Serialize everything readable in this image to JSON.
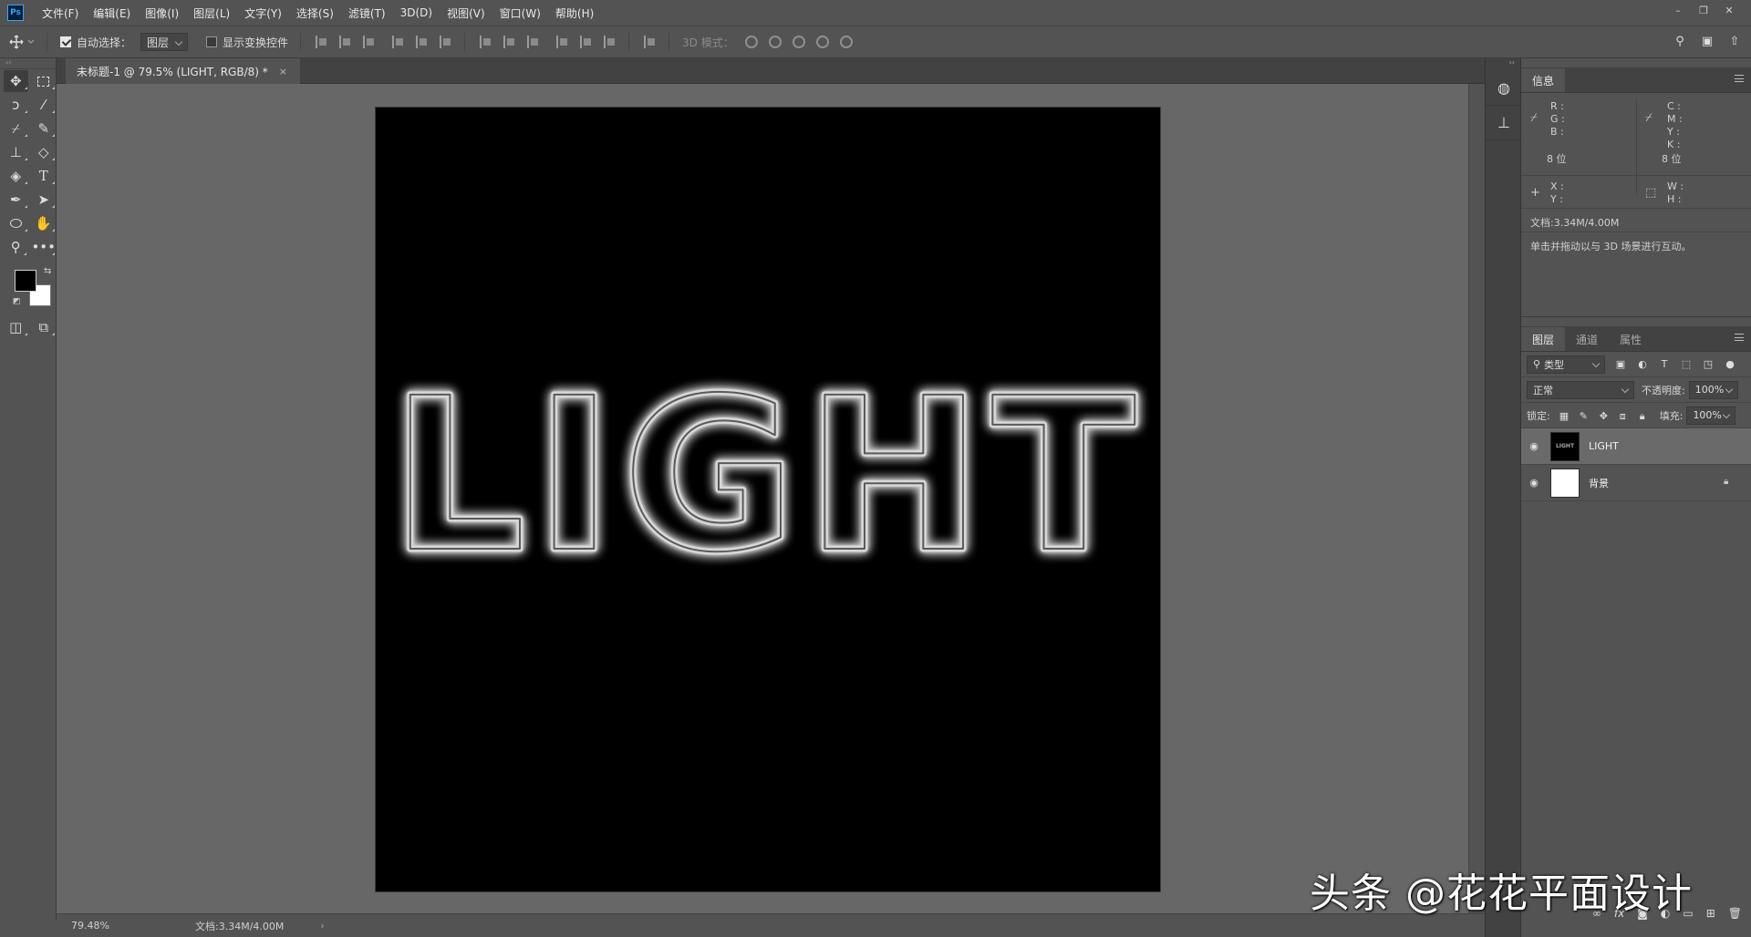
{
  "app": {
    "logo": "Ps",
    "menus": [
      "文件(F)",
      "编辑(E)",
      "图像(I)",
      "图层(L)",
      "文字(Y)",
      "选择(S)",
      "滤镜(T)",
      "3D(D)",
      "视图(V)",
      "窗口(W)",
      "帮助(H)"
    ],
    "window_controls": [
      "–",
      "❐",
      "✕"
    ]
  },
  "options_bar": {
    "auto_select_label": "自动选择：",
    "auto_select_checked": true,
    "auto_select_target": "图层",
    "show_transform_label": "显示变换控件",
    "show_transform_checked": false,
    "mode_3d_label": "3D 模式："
  },
  "document": {
    "tab_title": "未标题-1 @ 79.5% (LIGHT, RGB/8) *",
    "close_glyph": "×",
    "canvas_text": "LIGHT",
    "canvas_bg": "#000000",
    "glow_color": "#ffffff"
  },
  "status": {
    "zoom": "79.48%",
    "doc_info": "文档:3.34M/4.00M",
    "arrow": "›"
  },
  "info_panel": {
    "tab": "信息",
    "rgb_labels": [
      "R :",
      "G :",
      "B :"
    ],
    "cmyk_labels": [
      "C :",
      "M :",
      "Y :",
      "K :"
    ],
    "bits_left": "8 位",
    "bits_right": "8 位",
    "xy_labels": [
      "X :",
      "Y :"
    ],
    "wh_labels": [
      "W :",
      "H :"
    ],
    "doc_info": "文档:3.34M/4.00M",
    "hint": "单击并拖动以与 3D 场景进行互动。"
  },
  "layers_panel": {
    "tabs": [
      "图层",
      "通道",
      "属性"
    ],
    "filter_kind": "类型",
    "blend_mode": "正常",
    "opacity_label": "不透明度:",
    "opacity_value": "100%",
    "lock_label": "锁定:",
    "fill_label": "填充:",
    "fill_value": "100%",
    "layers": [
      {
        "name": "LIGHT",
        "visible": true,
        "selected": true,
        "locked": false
      },
      {
        "name": "背景",
        "visible": true,
        "selected": false,
        "locked": true
      }
    ],
    "footer_icons": [
      "link-icon",
      "fx-icon",
      "mask-icon",
      "adjustment-icon",
      "group-icon",
      "new-layer-icon",
      "trash-icon"
    ],
    "footer_fx": "fx"
  },
  "watermark": "头条 @花花平面设计"
}
